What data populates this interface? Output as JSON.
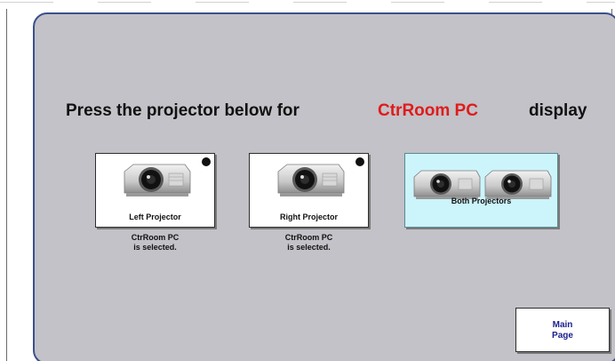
{
  "header": {
    "prompt_prefix": "Press the projector below for",
    "source_name": "CtrRoom PC",
    "prompt_suffix": "display"
  },
  "buttons": {
    "left_projector": {
      "label": "Left Projector",
      "status_line1": "CtrRoom PC",
      "status_line2": "is selected."
    },
    "right_projector": {
      "label": "Right Projector",
      "status_line1": "CtrRoom PC",
      "status_line2": "is selected."
    },
    "both_projectors": {
      "label": "Both Projectors"
    },
    "main_page": {
      "line1": "Main",
      "line2": "Page"
    }
  },
  "colors": {
    "panel_bg": "#c2c2c8",
    "panel_border": "#3b4f8c",
    "source_text": "#e01b1b",
    "selected_bg": "#ccf4fb",
    "main_page_text": "#1a1f8c"
  },
  "icons": {
    "projector": "projector-icon",
    "status_dot": "status-dot-icon"
  }
}
